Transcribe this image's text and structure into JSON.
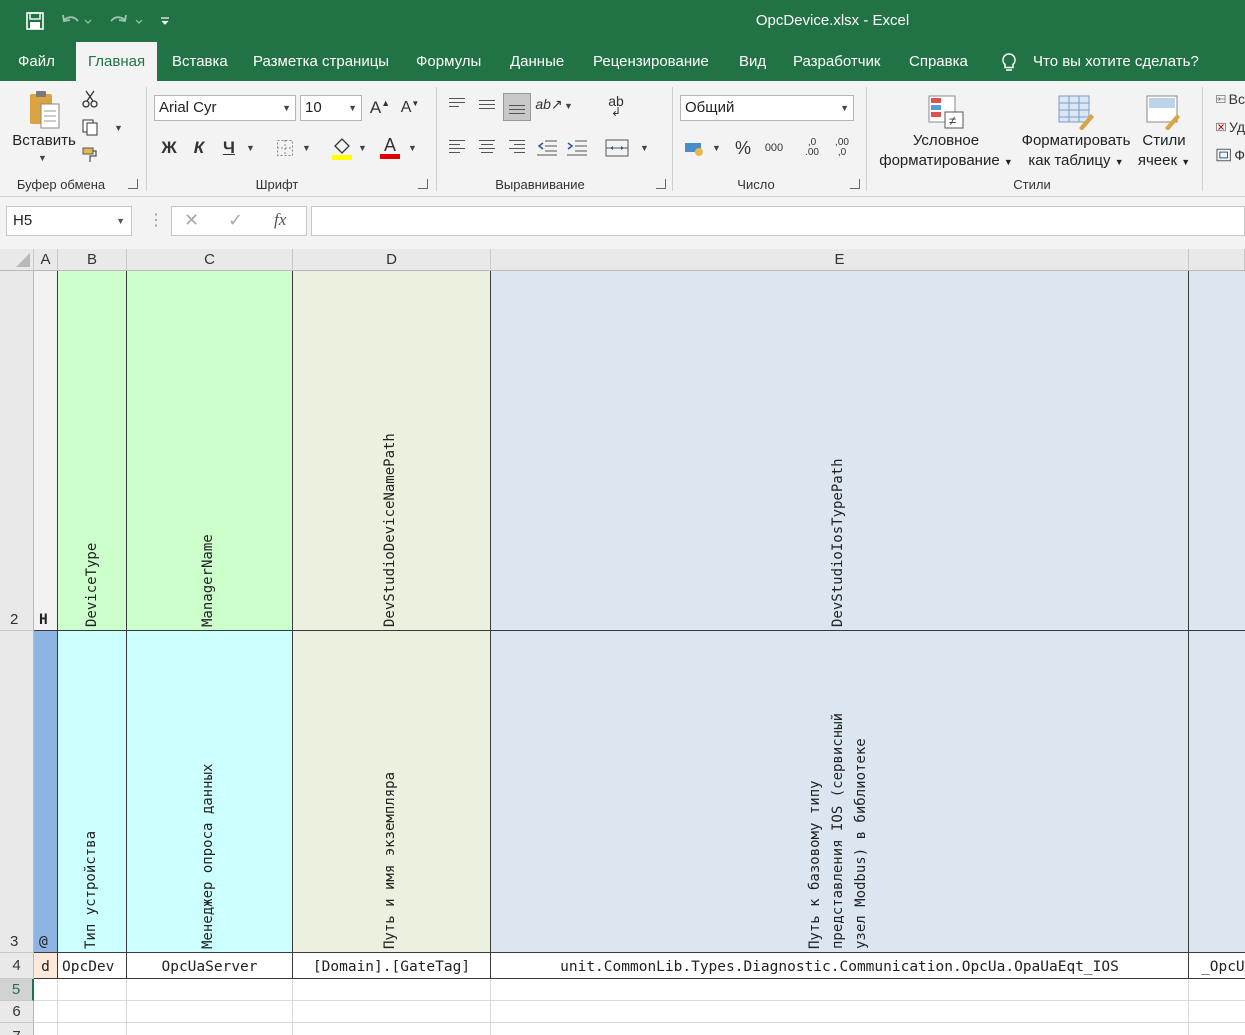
{
  "window": {
    "title": "OpcDevice.xlsx  -  Excel",
    "quick_access": {
      "customize_label": "⁼"
    }
  },
  "menu": {
    "tabs": [
      "Файл",
      "Главная",
      "Вставка",
      "Разметка страницы",
      "Формулы",
      "Данные",
      "Рецензирование",
      "Вид",
      "Разработчик",
      "Справка"
    ],
    "search_label": "Что вы хотите сделать?"
  },
  "ribbon": {
    "clipboard": {
      "paste_label": "Вставить",
      "group_label": "Буфер обмена"
    },
    "font": {
      "font_name": "Arial Cyr",
      "font_size": "10",
      "bold": "Ж",
      "italic": "К",
      "underline": "Ч",
      "grow": "A",
      "shrink": "A",
      "color_letter": "A",
      "group_label": "Шрифт"
    },
    "alignment": {
      "group_label": "Выравнивание",
      "wrap_label": "ab"
    },
    "number": {
      "format": "Общий",
      "percent": "%",
      "thousands": "000",
      "inc_dec": ",0",
      "dec_dec": ",00",
      "group_label": "Число"
    },
    "styles": {
      "conditional_line1": "Условное",
      "conditional_line2": "форматирование",
      "format_table_line1": "Форматировать",
      "format_table_line2": "как таблицу",
      "cell_styles_line1": "Стили",
      "cell_styles_line2": "ячеек",
      "group_label": "Стили"
    },
    "cells_partial": [
      "Вс",
      "Уд",
      "Ф"
    ]
  },
  "formula_bar": {
    "name_box": "H5",
    "fx_label": "fx",
    "cancel": "✕",
    "confirm": "✓",
    "content": ""
  },
  "sheet": {
    "column_headers": [
      "A",
      "B",
      "C",
      "D",
      "E"
    ],
    "row_headers": [
      "2",
      "3",
      "4",
      "5",
      "6",
      "7"
    ],
    "row2": {
      "a": "H",
      "b": "DeviceType",
      "c": "ManagerName",
      "d": "DevStudioDeviceNamePath",
      "e": "DevStudioIosTypePath"
    },
    "row3": {
      "a": "@",
      "b": "Тип устройства",
      "c": "Менеджер опроса данных",
      "d": "Путь и имя экземпляра",
      "e_lines": [
        "Путь к базовому типу",
        "представления IOS (сервисный",
        "узел Modbus) в библиотеке"
      ]
    },
    "row4": {
      "a": "d",
      "b": "OpcDev",
      "c": "OpcUaServer",
      "d": "[Domain].[GateTag]",
      "e": "unit.CommonLib.Types.Diagnostic.Communication.OpcUa.OpaUaEqt_IOS",
      "f": "_OpcU"
    },
    "colors": {
      "b_row2": "#ccffcc",
      "c_row2": "#ccffcc",
      "b_row3": "#ccffff",
      "c_row3": "#ccffff",
      "d_fill": "#ebf1de",
      "e_fill": "#dce6f1",
      "a_row3": "#8db4e2",
      "a_row4": "#fde9d9",
      "ribbon_green": "#217346"
    }
  }
}
